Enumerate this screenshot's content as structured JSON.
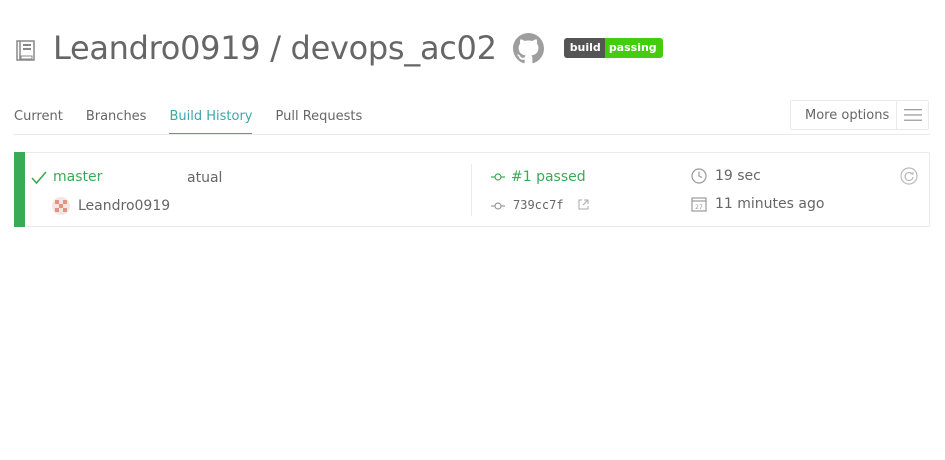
{
  "header": {
    "repo_title": "Leandro0919 / devops_ac02",
    "badge": {
      "left": "build",
      "right": "passing"
    }
  },
  "tabs": [
    {
      "label": "Current"
    },
    {
      "label": "Branches"
    },
    {
      "label": "Build History"
    },
    {
      "label": "Pull Requests"
    }
  ],
  "more_options": {
    "label": "More options"
  },
  "build": {
    "branch": "master",
    "message": "atual",
    "author": "Leandro0919",
    "build_number": "#1 passed",
    "commit": "739cc7f",
    "duration": "19 sec",
    "finished": "11 minutes ago"
  },
  "colors": {
    "passed": "#39aa56",
    "accent": "#3ba7a9",
    "text": "#666666",
    "badge_dark": "#555555",
    "badge_green": "#44cc11"
  }
}
